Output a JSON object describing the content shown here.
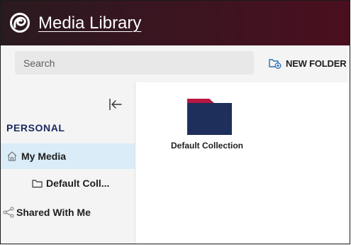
{
  "header": {
    "app_title": "Media Library",
    "logo_icon": "swirl-logo-icon"
  },
  "toolbar": {
    "search_placeholder": "Search",
    "new_folder_label": "NEW FOLDER",
    "new_folder_icon": "folder-plus-icon"
  },
  "sidebar": {
    "collapse_icon": "collapse-left-icon",
    "section_title": "PERSONAL",
    "items": [
      {
        "label": "My Media",
        "icon": "home-icon",
        "active": true
      },
      {
        "label": "Default Coll...",
        "icon": "folder-icon",
        "active": false
      },
      {
        "label": "Shared With Me",
        "icon": "share-icon",
        "active": false
      }
    ]
  },
  "main": {
    "folders": [
      {
        "label": "Default Collection",
        "icon": "folder-icon"
      }
    ]
  },
  "colors": {
    "header_bg": "#3c1420",
    "folder_body": "#1f2f5c",
    "folder_tab": "#b8173f",
    "active_item_bg": "#d9ecf7",
    "section_title": "#1a2a5e"
  }
}
